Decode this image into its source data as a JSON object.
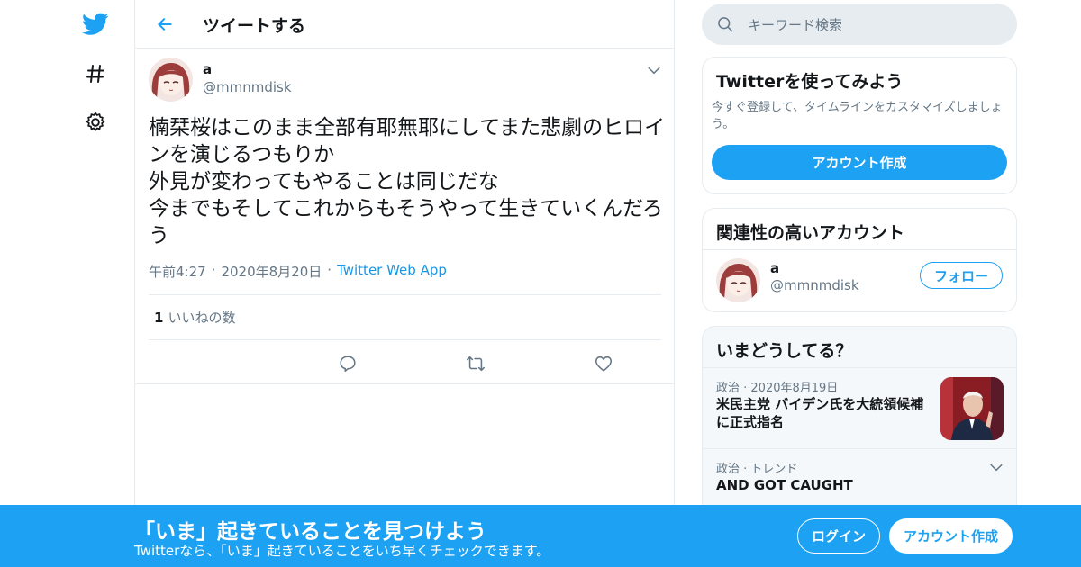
{
  "colors": {
    "accent": "#1da1f2",
    "text": "#14171a",
    "secondary": "#657786",
    "border": "#e6ecf0"
  },
  "nav": {
    "icons": [
      "twitter-logo-icon",
      "hashtag-icon",
      "settings-gear-icon"
    ]
  },
  "header": {
    "back_icon": "arrow-left-icon",
    "title": "ツイートする"
  },
  "tweet": {
    "author_name": "a",
    "author_handle": "@mmnmdisk",
    "text": "楠栞桜はこのまま全部有耶無耶にしてまた悲劇のヒロインを演じるつもりか\n外見が変わってもやることは同じだな\n今までもそしてこれからもそうやって生きていくんだろう",
    "time": "午前4:27",
    "date": "2020年8月20日",
    "separator": "·",
    "source": "Twitter Web App",
    "likes_count": "1",
    "likes_label": "いいねの数",
    "actions": [
      "reply-icon",
      "retweet-icon",
      "like-icon",
      "share-icon"
    ]
  },
  "search": {
    "placeholder": "キーワード検索"
  },
  "signup_card": {
    "title": "Twitterを使ってみよう",
    "description": "今すぐ登録して、タイムラインをカスタマイズしましょう。",
    "button": "アカウント作成"
  },
  "related_card": {
    "title": "関連性の高いアカウント",
    "account_name": "a",
    "account_handle": "@mmnmdisk",
    "follow_button": "フォロー"
  },
  "trends_card": {
    "title": "いまどうしてる？",
    "items": [
      {
        "meta": "政治 · 2020年8月19日",
        "title": "米民主党 バイデン氏を大統領候補に正式指名"
      },
      {
        "meta": "政治 · トレンド",
        "title": "AND GOT CAUGHT"
      }
    ]
  },
  "banner": {
    "title": "「いま」起きていることを見つけよう",
    "subtitle": "Twitterなら、「いま」起きていることをいち早くチェックできます。",
    "login": "ログイン",
    "signup": "アカウント作成"
  }
}
